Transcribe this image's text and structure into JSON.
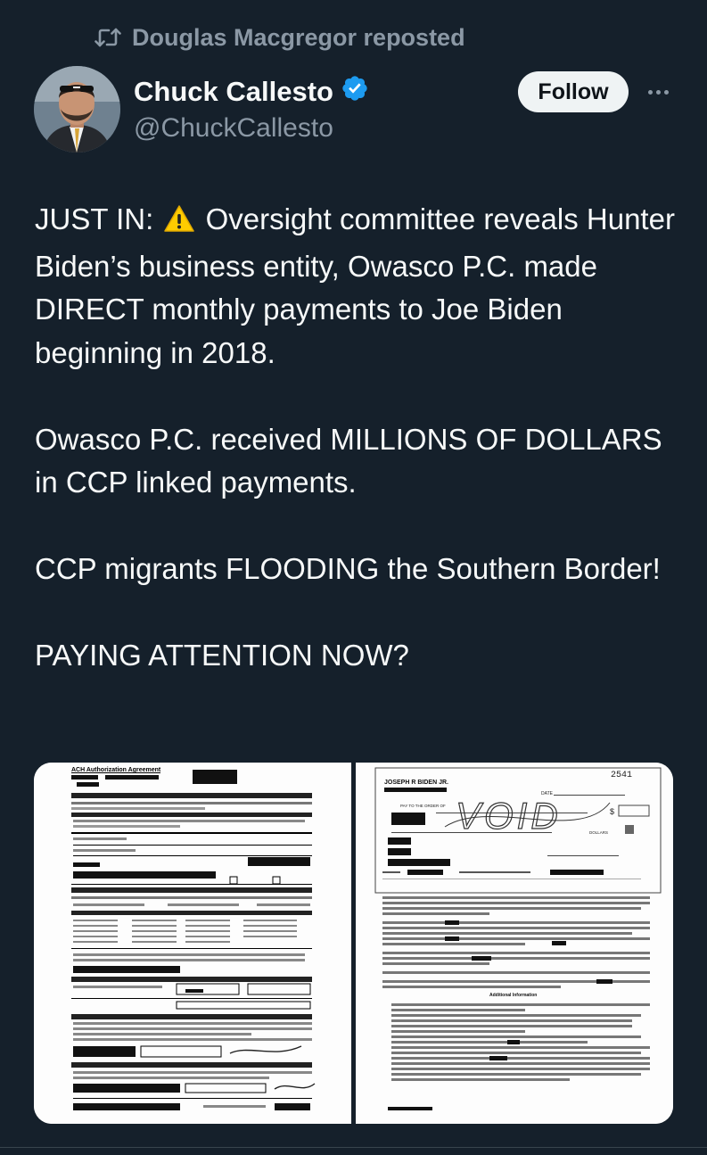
{
  "repost": {
    "icon": "repost-icon",
    "text": "Douglas Macgregor reposted"
  },
  "author": {
    "display_name": "Chuck Callesto",
    "handle": "@ChuckCallesto",
    "verified": true,
    "verified_color": "#1d9bf0"
  },
  "actions": {
    "follow_label": "Follow",
    "more_icon": "more-icon"
  },
  "tweet": {
    "paragraphs": [
      {
        "before_emoji": "JUST IN: ",
        "emoji": "warning-icon",
        "after_emoji": " Oversight committee reveals Hunter Biden’s business entity, Owasco P.C. made DIRECT monthly payments to Joe Biden beginning in 2018."
      },
      "Owasco P.C. received MILLIONS OF DOLLARS in CCP linked payments.",
      "CCP migrants FLOODING the Southern Border!",
      "PAYING ATTENTION NOW?"
    ]
  },
  "media": {
    "left_doc": {
      "title": "ACH Authorization Agreement"
    },
    "right_doc": {
      "check_number": "2541",
      "account_holder": "JOSEPH R BIDEN JR.",
      "date_label": "DATE",
      "pay_to_label": "PAY TO THE ORDER OF",
      "void_text": "VOID",
      "dollar_sign": "$",
      "dollars_label": "DOLLARS",
      "additional_info_title": "Additional Information"
    }
  },
  "colors": {
    "background": "#15202b",
    "text": "#f7f9f9",
    "secondary": "#8b98a5",
    "follow_bg": "#eff3f4"
  }
}
